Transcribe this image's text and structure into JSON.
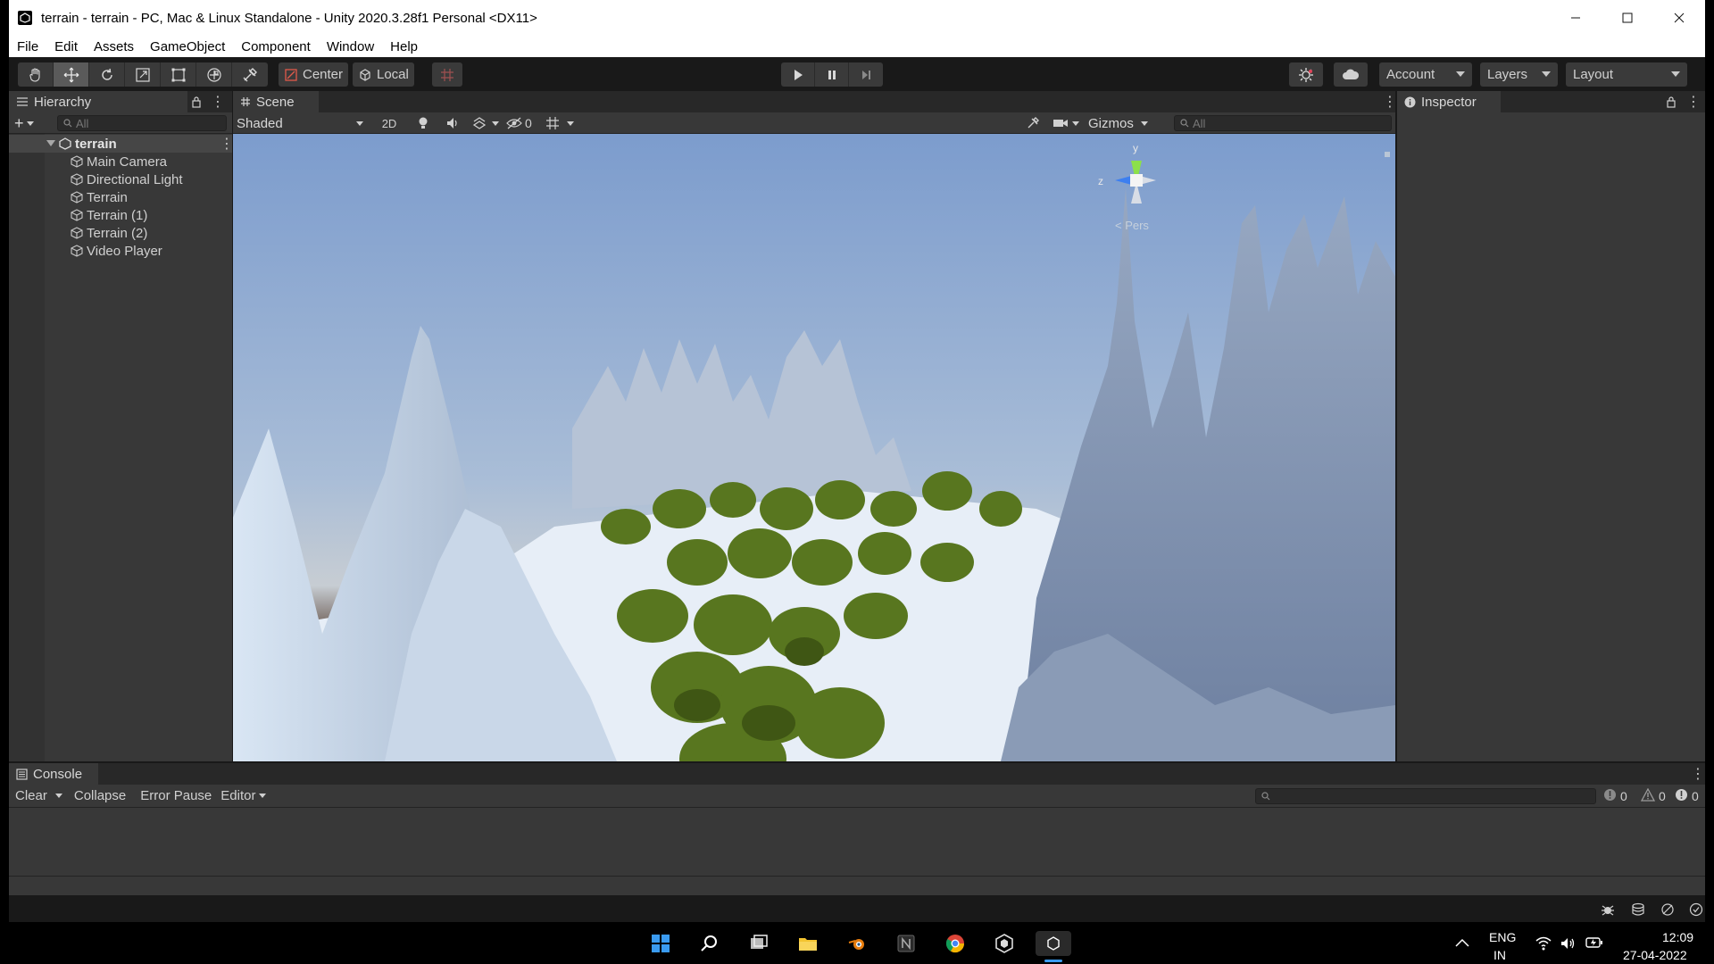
{
  "window": {
    "title": "terrain - terrain - PC, Mac & Linux Standalone - Unity 2020.3.28f1 Personal <DX11>",
    "controls": [
      "minimize-icon",
      "maximize-icon",
      "close-icon"
    ]
  },
  "menu": [
    "File",
    "Edit",
    "Assets",
    "GameObject",
    "Component",
    "Window",
    "Help"
  ],
  "toolbar": {
    "tools": [
      "hand-icon",
      "move-icon",
      "rotate-icon",
      "scale-icon",
      "rect-icon",
      "transform-icon",
      "custom-tool-icon"
    ],
    "active_tool": "move-icon",
    "pivot_label": "Center",
    "space_label": "Local",
    "account_label": "Account",
    "layers_label": "Layers",
    "layout_label": "Layout"
  },
  "hierarchy": {
    "tab_label": "Hierarchy",
    "search_placeholder": "All",
    "scene_name": "terrain",
    "items": [
      "Main Camera",
      "Directional Light",
      "Terrain",
      "Terrain (1)",
      "Terrain (2)",
      "Video Player"
    ]
  },
  "scene": {
    "tab_label": "Scene",
    "shading_mode": "Shaded",
    "mode_2d": "2D",
    "hidden_count": "0",
    "gizmos_label": "Gizmos",
    "search_placeholder": "All",
    "gizmo_y": "y",
    "gizmo_z": "z",
    "gizmo_persp": "< Pers"
  },
  "inspector": {
    "tab_label": "Inspector"
  },
  "console": {
    "tab_label": "Console",
    "clear_label": "Clear",
    "collapse_label": "Collapse",
    "error_pause_label": "Error Pause",
    "editor_label": "Editor",
    "log_count": "0",
    "warning_count": "0",
    "error_count": "0"
  },
  "taskbar": {
    "language": "ENG",
    "language_region": "IN",
    "time": "12:09",
    "date": "27-04-2022"
  },
  "colors": {
    "editor_bg": "#383838",
    "toolbar_bg": "#191919",
    "sky": "#8aa8d4",
    "snow": "#e4eef8",
    "tree": "#5d7a22"
  }
}
